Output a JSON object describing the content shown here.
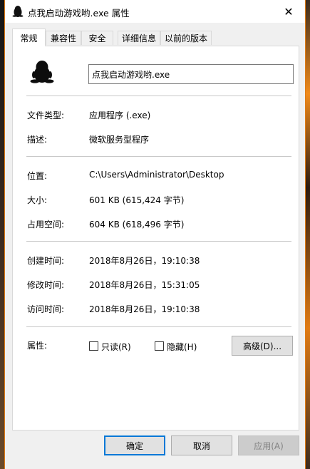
{
  "window": {
    "title": "点我启动游戏哟.exe 属性",
    "close_glyph": "✕"
  },
  "tabs": [
    {
      "label": "常规",
      "active": true
    },
    {
      "label": "兼容性"
    },
    {
      "label": "安全"
    },
    {
      "label": "详细信息"
    },
    {
      "label": "以前的版本"
    }
  ],
  "general": {
    "icon": "qq-penguin-icon",
    "filename": "点我启动游戏哟.exe",
    "rows": {
      "file_type": {
        "label": "文件类型:",
        "value": "应用程序 (.exe)"
      },
      "description": {
        "label": "描述:",
        "value": "微软服务型程序"
      },
      "location": {
        "label": "位置:",
        "value": "C:\\Users\\Administrator\\Desktop"
      },
      "size": {
        "label": "大小:",
        "value": "601 KB (615,424 字节)"
      },
      "size_on_disk": {
        "label": "占用空间:",
        "value": "604 KB (618,496 字节)"
      },
      "created": {
        "label": "创建时间:",
        "value": "2018年8月26日，19:10:38"
      },
      "modified": {
        "label": "修改时间:",
        "value": "2018年8月26日，15:31:05"
      },
      "accessed": {
        "label": "访问时间:",
        "value": "2018年8月26日，19:10:38"
      }
    },
    "attributes": {
      "label": "属性:",
      "readonly": {
        "label": "只读(R)",
        "checked": false
      },
      "hidden": {
        "label": "隐藏(H)",
        "checked": false
      },
      "advanced_button": "高级(D)..."
    }
  },
  "footer": {
    "ok": "确定",
    "cancel": "取消",
    "apply": "应用(A)"
  },
  "colors": {
    "accent": "#0078d7",
    "window_border": "#e07b14"
  }
}
